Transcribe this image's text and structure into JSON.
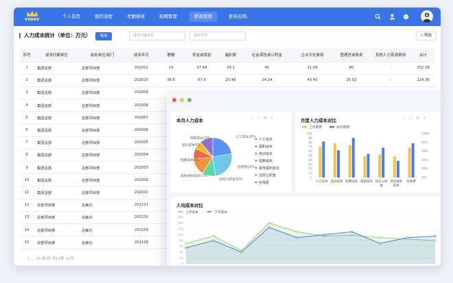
{
  "brand": {
    "logo_text": "VHDRK",
    "accent": "#3a74e6"
  },
  "nav": {
    "items": [
      {
        "label": "个人首页",
        "active": false
      },
      {
        "label": "我的流程",
        "active": false
      },
      {
        "label": "考勤排班",
        "active": false
      },
      {
        "label": "招聘管理",
        "active": false
      },
      {
        "label": "薪资管理",
        "active": true
      },
      {
        "label": "更多应用",
        "active": false
      }
    ],
    "icons": [
      "search-icon",
      "user-icon",
      "message-icon"
    ]
  },
  "toolbar": {
    "title": "人力成本统计（单位：万元）",
    "export_label": "导出",
    "search1_placeholder": "成本归属单位",
    "search2_placeholder": "成本年份",
    "filter_label": "筛选"
  },
  "table": {
    "headers": [
      "序号",
      "成本归属单位",
      "成本单位/部门",
      "成本年月",
      "薪酬",
      "奖金或奖励",
      "福利费",
      "社会保险或公积金",
      "企业文化费用",
      "管理咨询费用",
      "其他人力资源费用",
      "合计"
    ],
    "rows": [
      [
        "1",
        "集团总部",
        "总部项目部",
        "202011",
        "19",
        "37.64",
        "39.1",
        "45",
        "31.68",
        "80",
        "-",
        "252.38"
      ],
      [
        "2",
        "集团总部",
        "总部项目部",
        "202010",
        "38.6",
        "67.6",
        "25.48",
        "24.24",
        "43.42",
        "25.02",
        "-",
        "224.36"
      ],
      [
        "3",
        "集团总部",
        "总部项目部",
        "202009",
        "",
        "",
        "",
        "",
        "",
        "",
        "",
        ""
      ],
      [
        "4",
        "集团总部",
        "总部项目部",
        "202008",
        "",
        "",
        "",
        "",
        "",
        "",
        "",
        ""
      ],
      [
        "5",
        "集团总部",
        "总部项目部",
        "202007",
        "",
        "",
        "",
        "",
        "",
        "",
        "",
        ""
      ],
      [
        "6",
        "集团总部",
        "总部项目部",
        "202006",
        "",
        "",
        "",
        "",
        "",
        "",
        "",
        ""
      ],
      [
        "7",
        "集团总部",
        "总部项目部",
        "202005",
        "",
        "",
        "",
        "",
        "",
        "",
        "",
        ""
      ],
      [
        "8",
        "集团总部",
        "总部项目部",
        "202004",
        "",
        "",
        "",
        "",
        "",
        "",
        "",
        ""
      ],
      [
        "9",
        "集团总部",
        "总部项目部",
        "202003",
        "",
        "",
        "",
        "",
        "",
        "",
        "",
        ""
      ],
      [
        "10",
        "集团总部",
        "总部项目部",
        "202002",
        "",
        "",
        "",
        "",
        "",
        "",
        "",
        ""
      ],
      [
        "11",
        "集团总部",
        "总部项目部",
        "202001",
        "",
        "",
        "",
        "",
        "",
        "",
        "",
        ""
      ],
      [
        "12",
        "总部项目部",
        "总裁办",
        "202111",
        "",
        "",
        "",
        "",
        "",
        "",
        "",
        ""
      ],
      [
        "13",
        "总部项目部",
        "总裁办",
        "202110",
        "",
        "",
        "",
        "",
        "",
        "",
        "",
        ""
      ],
      [
        "14",
        "总部项目部",
        "总裁办",
        "202109",
        "",
        "",
        "",
        "",
        "",
        "",
        "",
        ""
      ],
      [
        "15",
        "总部项目部",
        "总裁办",
        "202108",
        "",
        "",
        "",
        "",
        "",
        "",
        "",
        ""
      ]
    ]
  },
  "pager": {
    "text": "1  ...  10 条/页  共15条 12页"
  },
  "popup": {
    "pie": {
      "title": "本月人力成本",
      "slice_labels": [
        "人工成本20%",
        "社保费23%",
        "住房公积金10%",
        "其他福利成本13%",
        "招聘成本8%",
        "培训成本6%",
        "离职成本10%"
      ],
      "legend": [
        "人工成本",
        "离职成本",
        "培训成本",
        "招聘成本",
        "其他福利成本",
        "住房公积金",
        "社保费"
      ]
    },
    "bar": {
      "title": "月度人力成本对比",
      "legend": [
        "上月费用",
        "本月费用"
      ]
    },
    "line": {
      "title": "人均成本对比",
      "legend": [
        "上月成本",
        "下月成本"
      ]
    }
  },
  "chart_data": [
    {
      "type": "pie",
      "title": "本月人力成本",
      "categories": [
        "人工成本",
        "社保费",
        "住房公积金",
        "其他福利成本",
        "招聘成本",
        "培训成本",
        "离职成本"
      ],
      "values": [
        20,
        23,
        10,
        13,
        8,
        6,
        10
      ],
      "colors": [
        "#5b8ff9",
        "#6dc8ec",
        "#5ad8a6",
        "#f6903d",
        "#e8684a",
        "#f6bd16",
        "#9270ca"
      ],
      "legend_position": "right"
    },
    {
      "type": "bar",
      "title": "月度人力成本对比",
      "categories": [
        "人工成本",
        "培训成本",
        "招聘成本",
        "离职成本",
        "住房公积金",
        "其他福利成本",
        "社保费"
      ],
      "series": [
        {
          "name": "上月费用",
          "values": [
            70,
            78,
            74,
            48,
            52,
            48,
            68
          ],
          "color": "#f6c342"
        },
        {
          "name": "本月费用",
          "values": [
            82,
            62,
            90,
            54,
            68,
            38,
            78
          ],
          "color": "#4a7ee8"
        }
      ],
      "ylim": [
        0,
        100
      ],
      "yticks_left": [
        "0",
        "10",
        "20",
        "30",
        "40",
        "50",
        "60",
        "70",
        "80",
        "90",
        "100"
      ],
      "yticks_right": [
        "0%",
        "20%",
        "40%",
        "60%",
        "80%",
        "100%"
      ],
      "legend_position": "top-left"
    },
    {
      "type": "area",
      "title": "人均成本对比",
      "series": [
        {
          "name": "上月成本",
          "values": [
            70,
            95,
            45,
            140,
            110,
            95,
            98,
            90,
            85,
            80
          ],
          "color": "#8fd16a"
        },
        {
          "name": "下月成本",
          "values": [
            55,
            80,
            40,
            125,
            90,
            100,
            110,
            70,
            90,
            95
          ],
          "color": "#4a7ee8"
        }
      ],
      "ylim": [
        0,
        160
      ],
      "yticks": [
        "0",
        "20",
        "40",
        "60",
        "80",
        "100",
        "120",
        "140",
        "160"
      ],
      "legend_position": "top-left"
    }
  ]
}
